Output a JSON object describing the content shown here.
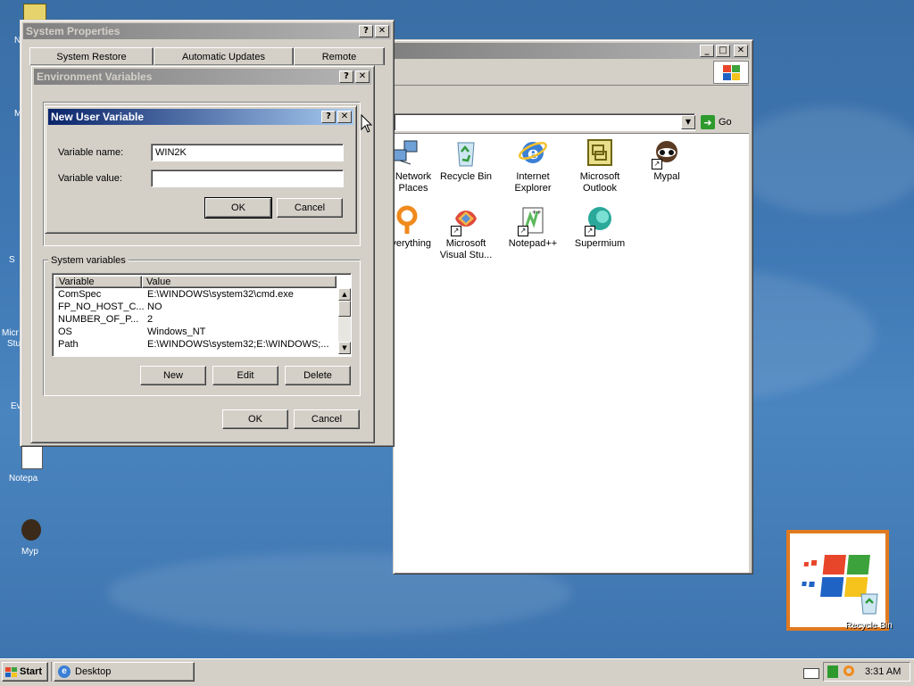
{
  "desktop": {
    "left_icons": [
      "N",
      "M",
      "S",
      "Micr",
      "Stu",
      "Ev",
      "Notepa",
      "Myp"
    ],
    "recycle_bin_label": "Recycle Bin"
  },
  "explorer": {
    "go_label": "Go",
    "icons": [
      {
        "name": "network",
        "label_1": "Network",
        "label_2": "Places"
      },
      {
        "name": "recycle-bin",
        "label_1": "Recycle Bin",
        "label_2": ""
      },
      {
        "name": "internet-explorer",
        "label_1": "Internet",
        "label_2": "Explorer"
      },
      {
        "name": "microsoft-outlook",
        "label_1": "Microsoft",
        "label_2": "Outlook"
      },
      {
        "name": "mypal",
        "label_1": "Mypal",
        "label_2": ""
      },
      {
        "name": "everything",
        "label_1": "Everything",
        "label_2": ""
      },
      {
        "name": "microsoft-visual-studio",
        "label_1": "Microsoft",
        "label_2": "Visual Stu..."
      },
      {
        "name": "notepad-plus-plus",
        "label_1": "Notepad++",
        "label_2": ""
      },
      {
        "name": "supermium",
        "label_1": "Supermium",
        "label_2": ""
      }
    ]
  },
  "system_properties": {
    "title": "System Properties",
    "tabs": [
      "System Restore",
      "Automatic Updates",
      "Remote"
    ]
  },
  "env_vars": {
    "title": "Environment Variables",
    "system_group_label": "System variables",
    "columns": [
      "Variable",
      "Value"
    ],
    "rows": [
      {
        "variable": "ComSpec",
        "value": "E:\\WINDOWS\\system32\\cmd.exe"
      },
      {
        "variable": "FP_NO_HOST_C...",
        "value": "NO"
      },
      {
        "variable": "NUMBER_OF_P...",
        "value": "2"
      },
      {
        "variable": "OS",
        "value": "Windows_NT"
      },
      {
        "variable": "Path",
        "value": "E:\\WINDOWS\\system32;E:\\WINDOWS;..."
      }
    ],
    "new_label": "New",
    "edit_label": "Edit",
    "delete_label": "Delete",
    "ok_label": "OK",
    "cancel_label": "Cancel"
  },
  "new_user_variable": {
    "title": "New User Variable",
    "name_label": "Variable name:",
    "name_value": "WIN2K",
    "value_label": "Variable value:",
    "value_value": "",
    "ok_label": "OK",
    "cancel_label": "Cancel"
  },
  "taskbar": {
    "start_label": "Start",
    "task_label": "Desktop",
    "clock": "3:31 AM"
  },
  "colors": {
    "active_title_start": "#0a246a",
    "active_title_end": "#a6caf0",
    "inactive_title_start": "#808080",
    "face": "#d4d0c8",
    "desktop": "#3a6ea5"
  }
}
